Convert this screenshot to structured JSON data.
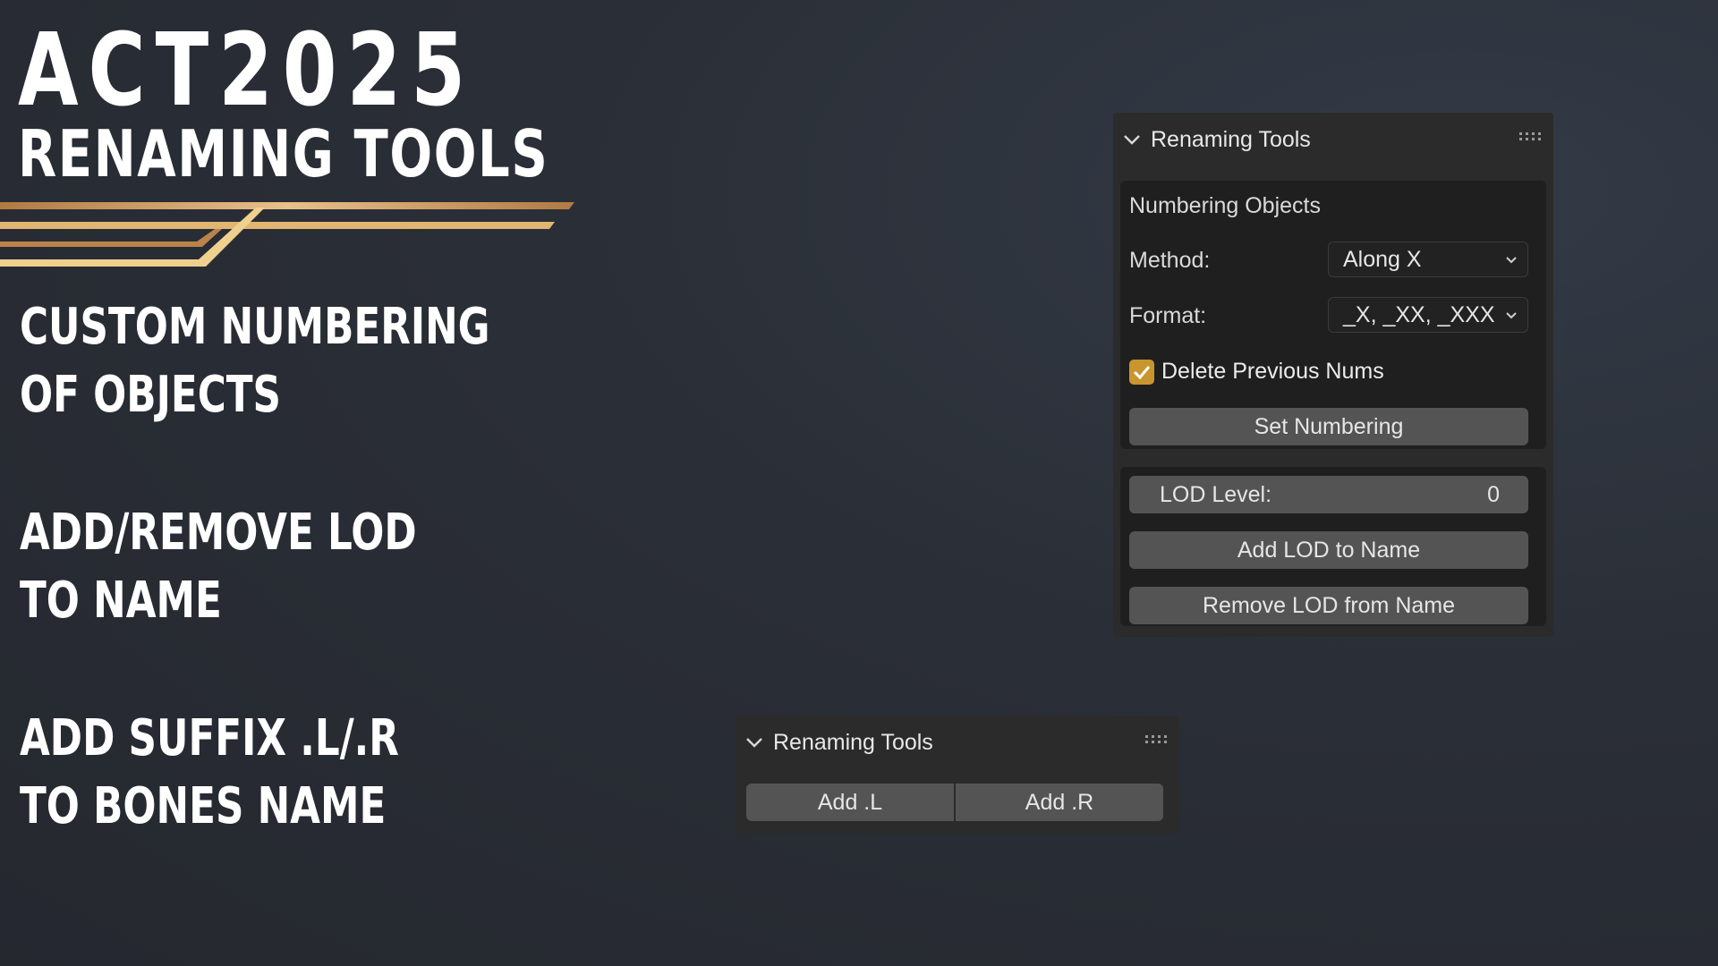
{
  "promo": {
    "title": "ACT2025",
    "subtitle": "RENAMING TOOLS",
    "features": [
      {
        "line1": "CUSTOM NUMBERING",
        "line2": "OF OBJECTS"
      },
      {
        "line1": "ADD/REMOVE LOD",
        "line2": "TO NAME"
      },
      {
        "line1": "ADD SUFFIX .L/.R",
        "line2": "TO BONES NAME"
      }
    ],
    "accent_colors": [
      "#b8834a",
      "#e2b46a",
      "#f0c98a"
    ]
  },
  "panel_main": {
    "header_title": "Renaming Tools",
    "header_icon": "chevron-down-icon",
    "grip_icon": "drag-grip-icon",
    "section_title": "Numbering Objects",
    "method_label": "Method:",
    "method_value": "Along X",
    "format_label": "Format:",
    "format_value": "_X, _XX, _XXX",
    "checkbox_label": "Delete Previous Nums",
    "checkbox_checked": true,
    "set_numbering_label": "Set Numbering",
    "lod_label": "LOD Level:",
    "lod_value": "0",
    "add_lod_label": "Add LOD to Name",
    "remove_lod_label": "Remove LOD from Name"
  },
  "panel_bones": {
    "header_title": "Renaming Tools",
    "add_l_label": "Add .L",
    "add_r_label": "Add .R"
  },
  "colors": {
    "panel_bg": "#2b2b2b",
    "box_bg": "#1f1f1f",
    "button_bg": "#545454",
    "checkbox_accent": "#c8952f"
  }
}
